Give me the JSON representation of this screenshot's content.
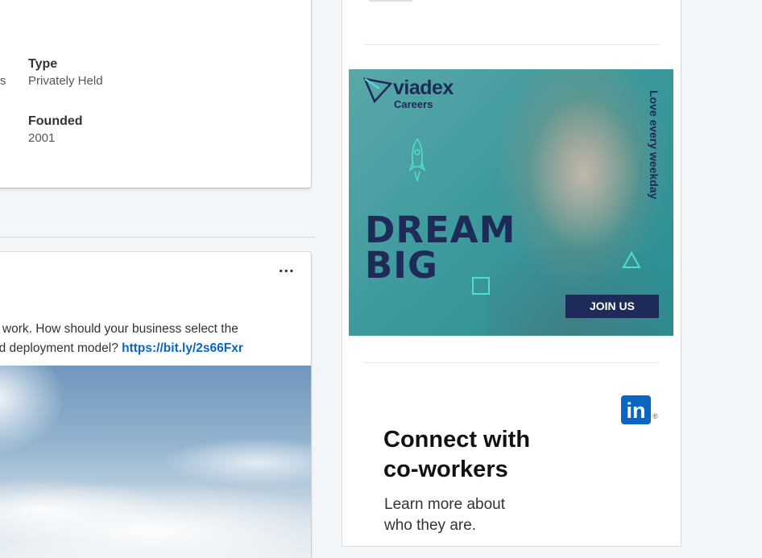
{
  "about": {
    "clipped_text": "s",
    "type_label": "Type",
    "type_value": "Privately Held",
    "founded_label": "Founded",
    "founded_value": "2001"
  },
  "post": {
    "more_label": "...",
    "line1": "e work. How should your business select the",
    "line2": "nd deployment model?",
    "link": "https://bit.ly/2s66Fxr"
  },
  "ad": {
    "brand": "viadex",
    "brand_sub": "Careers",
    "tagline": "Love every weekday",
    "headline_line1": "DREAM",
    "headline_line2": "BIG",
    "cta": "JOIN US",
    "colors": {
      "navy": "#1e2a57",
      "teal": "#3e9a9d",
      "accent": "#4fe0c8"
    }
  },
  "promo": {
    "logo": "in",
    "logo_reg": "®",
    "title_line1": "Connect with",
    "title_line2": "co-workers",
    "text_line1": "Learn more about",
    "text_line2": "who they are."
  },
  "colors": {
    "linkedin_blue": "#0a66c2",
    "background": "#f3f6f8"
  }
}
